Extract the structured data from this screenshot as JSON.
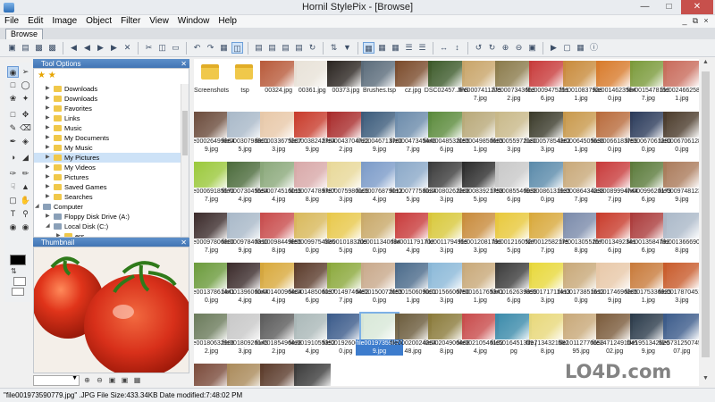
{
  "window": {
    "title": "Hornil StylePix - [Browse]"
  },
  "menu": [
    "File",
    "Edit",
    "Image",
    "Object",
    "Filter",
    "View",
    "Window",
    "Help"
  ],
  "tab": "Browse",
  "panels": {
    "tool_options": "Tool Options",
    "thumbnail": "Thumbnail"
  },
  "tree": [
    {
      "label": "Downloads",
      "indent": 1
    },
    {
      "label": "Downloads",
      "indent": 1
    },
    {
      "label": "Favorites",
      "indent": 1
    },
    {
      "label": "Links",
      "indent": 1
    },
    {
      "label": "Music",
      "indent": 1
    },
    {
      "label": "My Documents",
      "indent": 1
    },
    {
      "label": "My Music",
      "indent": 1
    },
    {
      "label": "My Pictures",
      "indent": 1,
      "selected": true
    },
    {
      "label": "My Videos",
      "indent": 1
    },
    {
      "label": "Pictures",
      "indent": 1
    },
    {
      "label": "Saved Games",
      "indent": 1
    },
    {
      "label": "Searches",
      "indent": 1
    },
    {
      "label": "Computer",
      "indent": 0
    },
    {
      "label": "Floppy Disk Drive (A:)",
      "indent": 1
    },
    {
      "label": "Local Disk (C:)",
      "indent": 1
    },
    {
      "label": "ers",
      "indent": 2
    }
  ],
  "files": [
    {
      "name": "Screenshots",
      "folder": true
    },
    {
      "name": "tsp",
      "folder": true
    },
    {
      "name": "00324.jpg",
      "color": "#b85a3a"
    },
    {
      "name": "00361.jpg",
      "color": "#e8e2d8"
    },
    {
      "name": "00373.jpg",
      "color": "#2a2420"
    },
    {
      "name": "Brushes.tsp",
      "color": "#5a6b7a"
    },
    {
      "name": "cz.jpg",
      "color": "#7a4a2a"
    },
    {
      "name": "DSC02457.JPG",
      "color": "#3c5a2a"
    },
    {
      "name": "file00074112757.jpg",
      "color": "#c8a468"
    },
    {
      "name": "file00073436532.jpg",
      "color": "#8a7a4a"
    },
    {
      "name": "file00094752516.jpg",
      "color": "#c83a3a"
    },
    {
      "name": "file00108379281.jpg",
      "color": "#c88a3a"
    },
    {
      "name": "file00146235840.jpg",
      "color": "#d87a2a"
    },
    {
      "name": "file00154781507.jpg",
      "color": "#7a9a3a"
    },
    {
      "name": "file00246625831.jpg",
      "color": "#c86a5a"
    },
    {
      "name": "file000264998649.jpg",
      "color": "#6a4a3a"
    },
    {
      "name": "file000307988015.jpg",
      "color": "#a8b8c8"
    },
    {
      "name": "file000336753073.jpg",
      "color": "#e8c8a8"
    },
    {
      "name": "file000382427649.jpg",
      "color": "#c83a2a"
    },
    {
      "name": "file000437047222.jpg",
      "color": "#a82a2a"
    },
    {
      "name": "file000467137609.jpg",
      "color": "#3a5a7a"
    },
    {
      "name": "file000473454467.jpg",
      "color": "#6a8aaa"
    },
    {
      "name": "file000485320556.jpg",
      "color": "#5a8a3a"
    },
    {
      "name": "file000498506651.jpg",
      "color": "#b8a878"
    },
    {
      "name": "file000559721803.jpg",
      "color": "#c8b888"
    },
    {
      "name": "file000578543623.jpg",
      "color": "#3a3a2a"
    },
    {
      "name": "file000645056361.jpg",
      "color": "#c8984a"
    },
    {
      "name": "file000661837590.jpg",
      "color": "#b86a3a"
    },
    {
      "name": "file000670612800.jpg",
      "color": "#2a3a5a"
    },
    {
      "name": "file000670612800.jpg",
      "color": "#4a3a2a"
    },
    {
      "name": "file000691855707.jpg",
      "color": "#9ac83a"
    },
    {
      "name": "file000730455544.jpg",
      "color": "#4a6a3a"
    },
    {
      "name": "file000745160194.jpg",
      "color": "#8aa87a"
    },
    {
      "name": "file000747897878.jpg",
      "color": "#d8a8a8"
    },
    {
      "name": "file000759801093.jpg",
      "color": "#e8d898"
    },
    {
      "name": "file000768790124.jpg",
      "color": "#7a9ac8"
    },
    {
      "name": "file000777580245.jpg",
      "color": "#8aa8c8"
    },
    {
      "name": "file000802623083.jpg",
      "color": "#3a3a3a"
    },
    {
      "name": "file000839217585.jpg",
      "color": "#2a2a2a"
    },
    {
      "name": "file000855469386.jpg",
      "color": "#c8c8c8"
    },
    {
      "name": "file000861319350.jpg",
      "color": "#5a8aaa"
    },
    {
      "name": "file000864342387.jpg",
      "color": "#c8a878"
    },
    {
      "name": "file000899947447.jpg",
      "color": "#c83a3a"
    },
    {
      "name": "file000996201796.jpg",
      "color": "#5a7a3a"
    },
    {
      "name": "file000974812389.jpg",
      "color": "#aa7a5a"
    },
    {
      "name": "file000978068007.jpg",
      "color": "#3a2a2a"
    },
    {
      "name": "file000978403109.jpg",
      "color": "#a8b8c8"
    },
    {
      "name": "file000984498558.jpg",
      "color": "#c84a4a"
    },
    {
      "name": "file000997543350.jpg",
      "color": "#d8b85a"
    },
    {
      "name": "file00101832095.jpg",
      "color": "#e8c84a"
    },
    {
      "name": "file00113406840.jpg",
      "color": "#c8a868"
    },
    {
      "name": "file00117917024.jpg",
      "color": "#c83a3a"
    },
    {
      "name": "file00117949593.jpg",
      "color": "#d8c83a"
    },
    {
      "name": "file00120817903.jpg",
      "color": "#c88a3a"
    },
    {
      "name": "file00121605275.jpg",
      "color": "#e8c83a"
    },
    {
      "name": "file00125821757.jpg",
      "color": "#d8a83a"
    },
    {
      "name": "file00130552578.jpg",
      "color": "#7a8aaa"
    },
    {
      "name": "file00134923416.jpg",
      "color": "#c83a2a"
    },
    {
      "name": "file00135847826.jpg",
      "color": "#aa3a3a"
    },
    {
      "name": "file00136669078.jpg",
      "color": "#aab8c8"
    },
    {
      "name": "file001378614410.jpg",
      "color": "#6a9a3a"
    },
    {
      "name": "file001396060444.jpg",
      "color": "#3a2a2a"
    },
    {
      "name": "file001400964044.jpg",
      "color": "#d8a83a"
    },
    {
      "name": "file001485060376.jpg",
      "color": "#5a3a2a"
    },
    {
      "name": "file001497464527.jpg",
      "color": "#8aa83a"
    },
    {
      "name": "file001500726550.jpg",
      "color": "#c8a88a"
    },
    {
      "name": "file001506090011.jpg",
      "color": "#4a6a8a"
    },
    {
      "name": "file001566067503.jpg",
      "color": "#8ab8d8"
    },
    {
      "name": "file001617653411.jpg",
      "color": "#c8a878"
    },
    {
      "name": "file001626398996.jpg",
      "color": "#3a3a3a"
    },
    {
      "name": "file001717114133.jpg",
      "color": "#e8d83a"
    },
    {
      "name": "file001738516120.jpg",
      "color": "#c8a878"
    },
    {
      "name": "file001746963059.jpg",
      "color": "#e8c8a8"
    },
    {
      "name": "file001753368251.jpg",
      "color": "#c87a3a"
    },
    {
      "name": "file001787045163.jpg",
      "color": "#c85a2a"
    },
    {
      "name": "file001806329062.jpg",
      "color": "#6a7a5a"
    },
    {
      "name": "file001809261453.jpg",
      "color": "#c8c8c8"
    },
    {
      "name": "file001854964282.jpg",
      "color": "#5a5a5a"
    },
    {
      "name": "file001910553524.jpg",
      "color": "#aab8b8"
    },
    {
      "name": "file001926068290.jpg",
      "color": "#3a5a8a"
    },
    {
      "name": "file001973590779.jpg",
      "color": "#d8e8d8",
      "selected": true
    },
    {
      "name": "file0002002426448.jpg",
      "color": "#6a5a3a"
    },
    {
      "name": "file002049064688.jpg",
      "color": "#8a7a3a"
    },
    {
      "name": "file002105461024.jpg",
      "color": "#c84a4a"
    },
    {
      "name": "file5016451309.jpg",
      "color": "#3a8aaa"
    },
    {
      "name": "file71343216828.jpg",
      "color": "#e8d87a"
    },
    {
      "name": "file1011277665895.jpg",
      "color": "#c8a878"
    },
    {
      "name": "file1471249104502.jpg",
      "color": "#7a5a3a"
    },
    {
      "name": "file19513426209.jpg",
      "color": "#2a3a4a"
    },
    {
      "name": "file5731250745607.jpg",
      "color": "#3a5a8a"
    },
    {
      "name": "",
      "color": "#7a4a3a"
    },
    {
      "name": "",
      "color": "#aa8a5a"
    },
    {
      "name": "",
      "color": "#5a3a2a"
    },
    {
      "name": "",
      "color": "#3a3a3a"
    }
  ],
  "status": "\"file001973590779.jpg\" .JPG File Size:433.34KB Date modified:7:48:02 PM",
  "watermark": "LO4D.com"
}
